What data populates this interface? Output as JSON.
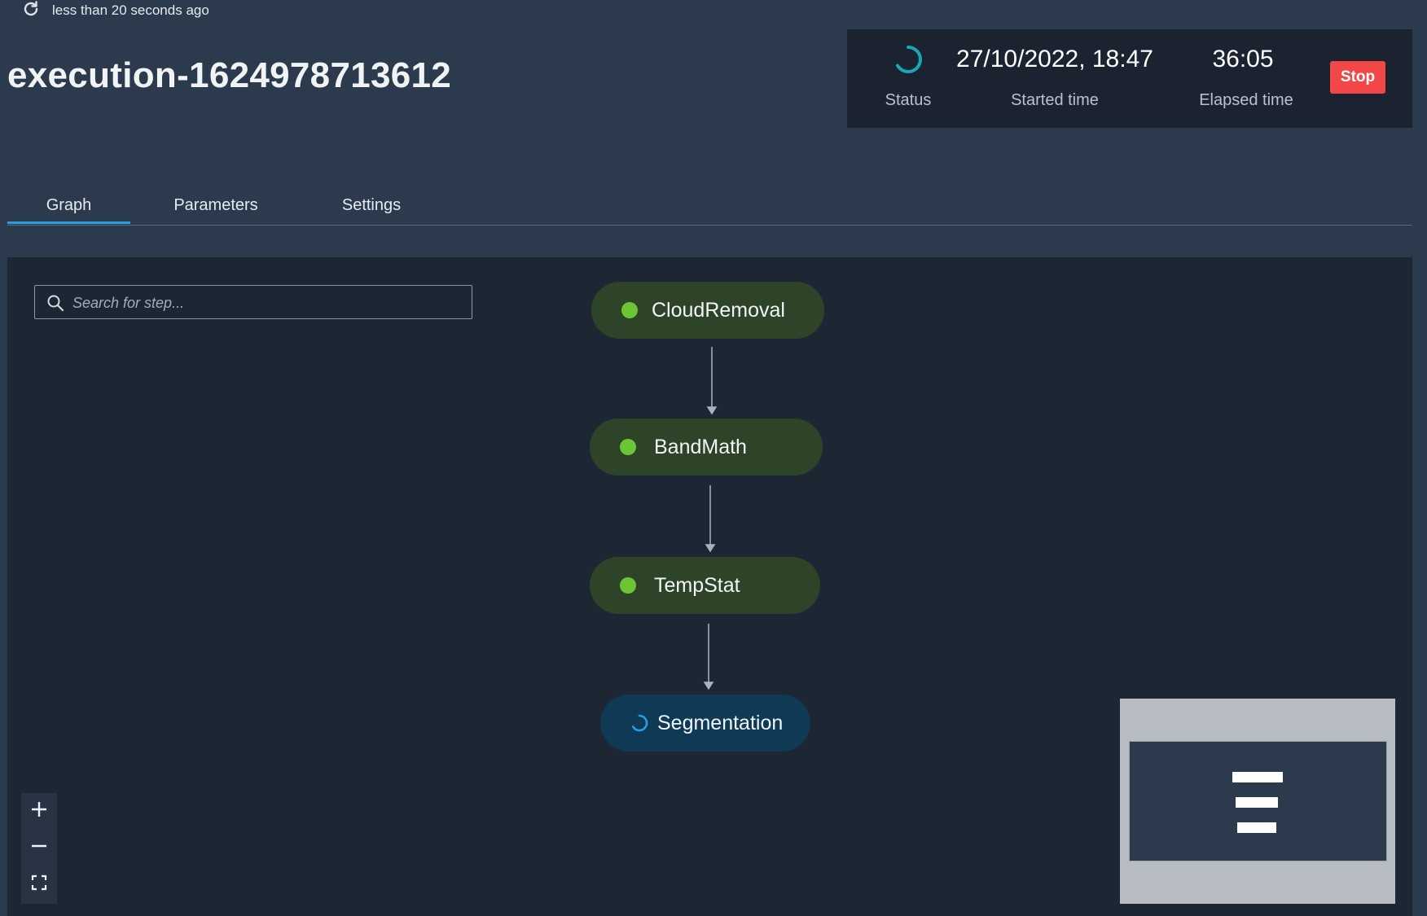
{
  "refresh": {
    "icon": "refresh-icon",
    "text": "less than 20 seconds ago"
  },
  "execution": {
    "title": "execution-1624978713612"
  },
  "status_panel": {
    "status_icon": "spinner-icon",
    "status_label": "Status",
    "started_time": "27/10/2022, 18:47",
    "started_label": "Started time",
    "elapsed_time": "36:05",
    "elapsed_label": "Elapsed time",
    "stop_label": "Stop"
  },
  "tabs": [
    {
      "label": "Graph",
      "active": true
    },
    {
      "label": "Parameters",
      "active": false
    },
    {
      "label": "Settings",
      "active": false
    }
  ],
  "search": {
    "placeholder": "Search for step...",
    "value": "",
    "icon": "search-icon"
  },
  "graph": {
    "steps": [
      {
        "name": "CloudRemoval",
        "status": "succeeded"
      },
      {
        "name": "BandMath",
        "status": "succeeded"
      },
      {
        "name": "TempStat",
        "status": "succeeded"
      },
      {
        "name": "Segmentation",
        "status": "running"
      }
    ],
    "colors": {
      "succeeded_dot": "#6cc534",
      "succeeded_bg": "#2d4428",
      "running_bg": "#0f3a56",
      "running_icon": "#2b9de3"
    }
  },
  "zoom_controls": {
    "zoom_in_icon": "plus-icon",
    "zoom_out_icon": "minus-icon",
    "fit_icon": "fit-view-icon"
  },
  "colors": {
    "accent": "#2b9de3",
    "stop": "#f24747",
    "background": "#2c3a4d",
    "canvas": "#1d2633"
  }
}
